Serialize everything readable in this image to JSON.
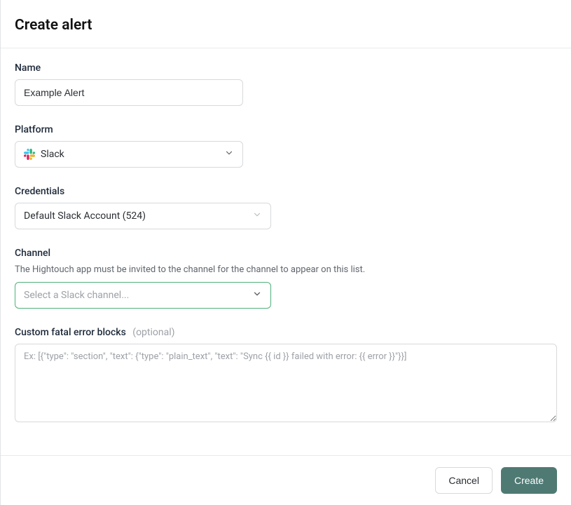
{
  "header": {
    "title": "Create alert"
  },
  "name_field": {
    "label": "Name",
    "value": "Example Alert"
  },
  "platform_field": {
    "label": "Platform",
    "value": "Slack"
  },
  "credentials_field": {
    "label": "Credentials",
    "value": "Default Slack Account (524)"
  },
  "channel_field": {
    "label": "Channel",
    "help": "The Hightouch app must be invited to the channel for the channel to appear on this list.",
    "placeholder": "Select a Slack channel..."
  },
  "custom_blocks_field": {
    "label": "Custom fatal error blocks",
    "optional": "(optional)",
    "placeholder": "Ex: [{\"type\": \"section\", \"text\": {\"type\": \"plain_text\", \"text\": \"Sync {{ id }} failed with error: {{ error }}\"}}]"
  },
  "footer": {
    "cancel": "Cancel",
    "create": "Create"
  }
}
